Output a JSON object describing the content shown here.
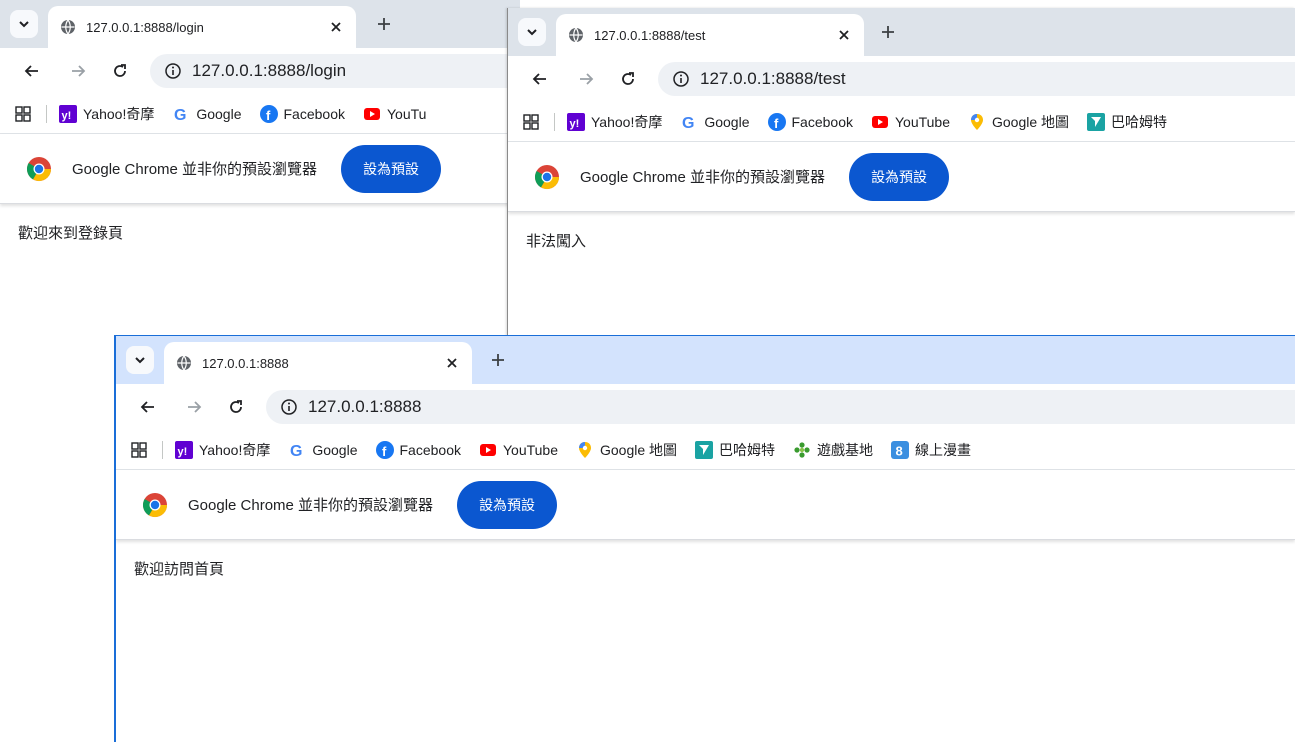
{
  "tabsearch_icon": "chevron-down-icon",
  "bookmarks": {
    "items": [
      {
        "label": "Yahoo!奇摩",
        "icon": "yahoo-icon",
        "color": "#6001d2"
      },
      {
        "label": "Google",
        "icon": "google-icon",
        "color": "#4285f4"
      },
      {
        "label": "Facebook",
        "icon": "facebook-icon",
        "color": "#1877f2"
      },
      {
        "label": "YouTube",
        "icon": "youtube-icon",
        "color": "#ff0000"
      },
      {
        "label": "Google 地圖",
        "icon": "maps-pin-icon",
        "color": "#fbbc04"
      },
      {
        "label": "巴哈姆特",
        "icon": "bahamut-icon",
        "color": "#1aa3a3"
      },
      {
        "label": "遊戲基地",
        "icon": "gamebase-icon",
        "color": "#3a9b2f"
      },
      {
        "label": "線上漫畫",
        "icon": "comic-icon",
        "color": "#3b8fe0"
      }
    ],
    "truncated_youtube": "YouTu"
  },
  "infobar": {
    "message": "Google Chrome 並非你的預設瀏覽器",
    "button": "設為預設"
  },
  "windows": [
    {
      "tab_title": "127.0.0.1:8888/login",
      "url": "127.0.0.1:8888/login",
      "page_text": "歡迎來到登錄頁"
    },
    {
      "tab_title": "127.0.0.1:8888/test",
      "url": "127.0.0.1:8888/test",
      "page_text": "非法闖入"
    },
    {
      "tab_title": "127.0.0.1:8888",
      "url": "127.0.0.1:8888",
      "page_text": "歡迎訪問首頁"
    }
  ],
  "colors": {
    "accent": "#0b57d0",
    "active_tabstrip": "#d3e3fd",
    "inactive_tabstrip": "#dde3ea"
  }
}
